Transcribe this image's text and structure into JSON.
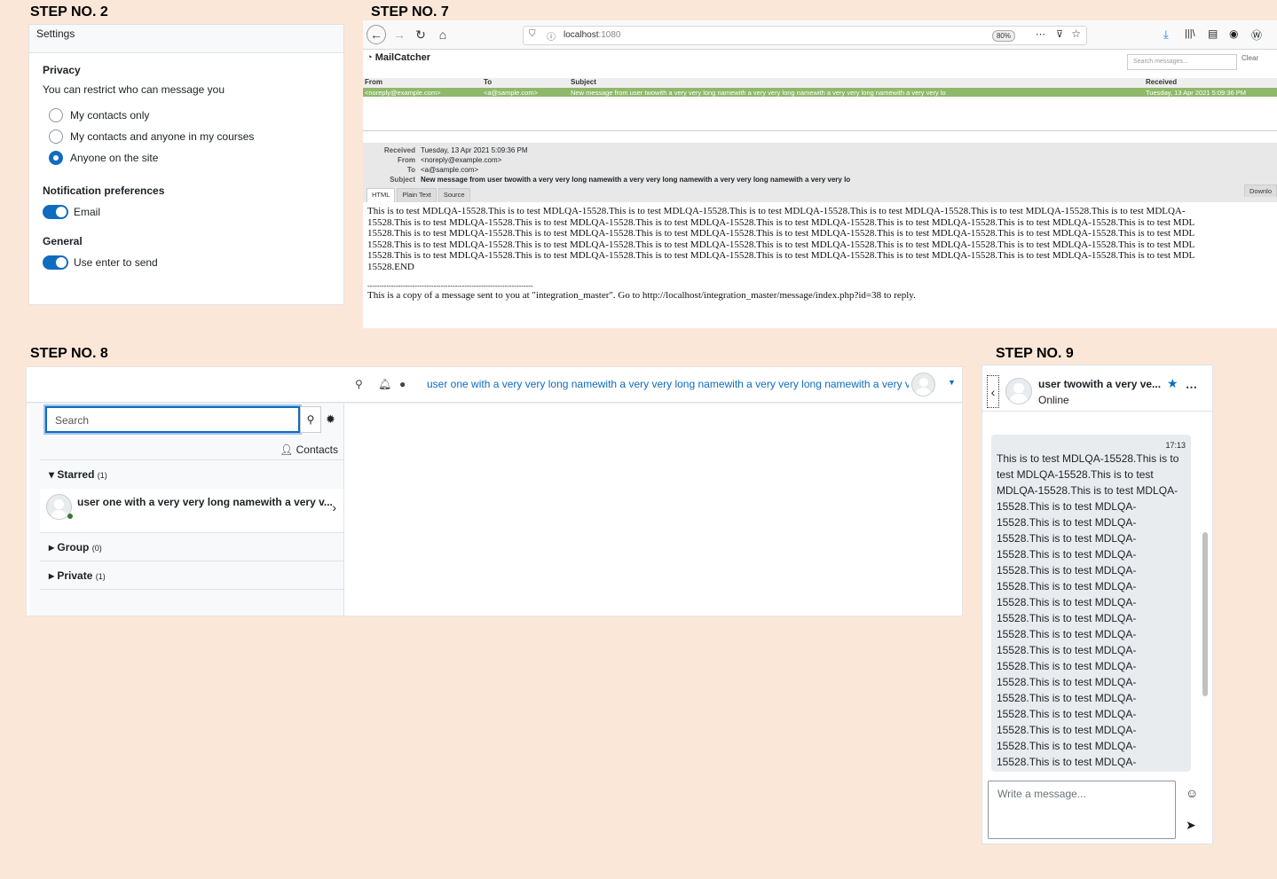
{
  "labels": {
    "step2": "STEP NO. 2",
    "step7": "STEP NO. 7",
    "step8": "STEP NO. 8",
    "step9": "STEP NO. 9"
  },
  "step2": {
    "header": "Settings",
    "privacy_title": "Privacy",
    "privacy_desc": "You can restrict who can message you",
    "options": [
      "My contacts only",
      "My contacts and anyone in my courses",
      "Anyone on the site"
    ],
    "selected_option": "Anyone on the site",
    "notif_title": "Notification preferences",
    "email_label": "Email",
    "general_title": "General",
    "enter_label": "Use enter to send"
  },
  "step7": {
    "url": "localhost",
    "url_port": ":1080",
    "zoom": "80%",
    "app_title": "MailCatcher",
    "search_placeholder": "Search messages...",
    "clear_label": "Clear",
    "columns": {
      "from": "From",
      "to": "To",
      "subject": "Subject",
      "received": "Received"
    },
    "row": {
      "from": "<noreply@example.com>",
      "to": "<a@sample.com>",
      "subject": "New message from user twowith a very very long namewith a very very long namewith a very very long namewith a very very lo",
      "received": "Tuesday, 13 Apr 2021 5:09:36 PM"
    },
    "meta": {
      "received_k": "Received",
      "received_v": "Tuesday, 13 Apr 2021 5:09:36 PM",
      "from_k": "From",
      "from_v": "<noreply@example.com>",
      "to_k": "To",
      "to_v": "<a@sample.com>",
      "subject_k": "Subject",
      "subject_v": "New message from user twowith a very very long namewith a very very long namewith a very very long namewith a very very lo"
    },
    "tabs": [
      "HTML",
      "Plain Text",
      "Source"
    ],
    "download": "Downlo",
    "body_lines": [
      "This is to test MDLQA-15528.This is to test MDLQA-15528.This is to test MDLQA-15528.This is to test MDLQA-15528.This is to test MDLQA-15528.This is to test MDLQA-15528.This is to test MDLQA-",
      "15528.This is to test MDLQA-15528.This is to test MDLQA-15528.This is to test MDLQA-15528.This is to test MDLQA-15528.This is to test MDLQA-15528.This is to test MDLQA-15528.This is to test MDL",
      "15528.This is to test MDLQA-15528.This is to test MDLQA-15528.This is to test MDLQA-15528.This is to test MDLQA-15528.This is to test MDLQA-15528.This is to test MDLQA-15528.This is to test MDL",
      "15528.This is to test MDLQA-15528.This is to test MDLQA-15528.This is to test MDLQA-15528.This is to test MDLQA-15528.This is to test MDLQA-15528.This is to test MDLQA-15528.This is to test MDL",
      "15528.This is to test MDLQA-15528.This is to test MDLQA-15528.This is to test MDLQA-15528.This is to test MDLQA-15528.This is to test MDLQA-15528.This is to test MDLQA-15528.This is to test MDL",
      "15528.END"
    ],
    "separator": "----------------------------------------------------------------------",
    "footer": "This is a copy of a message sent to you at \"integration_master\". Go to http://localhost/integration_master/message/index.php?id=38 to reply."
  },
  "step8": {
    "user_name": "user one with a very very long namewith a very very long namewith a very very long namewith a very very l",
    "search_placeholder": "Search",
    "contacts_label": "Contacts",
    "starred": "Starred",
    "starred_count": "(1)",
    "contact_name": "user one with a very very long namewith a very v...",
    "group": "Group",
    "group_count": "(0)",
    "private": "Private",
    "private_count": "(1)"
  },
  "step9": {
    "contact_name": "user twowith a very ve...",
    "status": "Online",
    "time": "17:13",
    "message_lines": [
      "This is to test MDLQA-15528.This is to",
      "test MDLQA-15528.This is to test",
      "MDLQA-15528.This is to test MDLQA-",
      "15528.This is to test MDLQA-",
      "15528.This is to test MDLQA-",
      "15528.This is to test MDLQA-",
      "15528.This is to test MDLQA-",
      "15528.This is to test MDLQA-",
      "15528.This is to test MDLQA-",
      "15528.This is to test MDLQA-",
      "15528.This is to test MDLQA-",
      "15528.This is to test MDLQA-",
      "15528.This is to test MDLQA-",
      "15528.This is to test MDLQA-",
      "15528.This is to test MDLQA-",
      "15528.This is to test MDLQA-",
      "15528.This is to test MDLQA-",
      "15528.This is to test MDLQA-",
      "15528.This is to test MDLQA-",
      "15528.This is to test MDLQA-"
    ],
    "input_placeholder": "Write a message..."
  },
  "colors": {
    "accent": "#0f6cbf",
    "background": "#fbe7d8",
    "mail_row": "#8fb86a"
  }
}
